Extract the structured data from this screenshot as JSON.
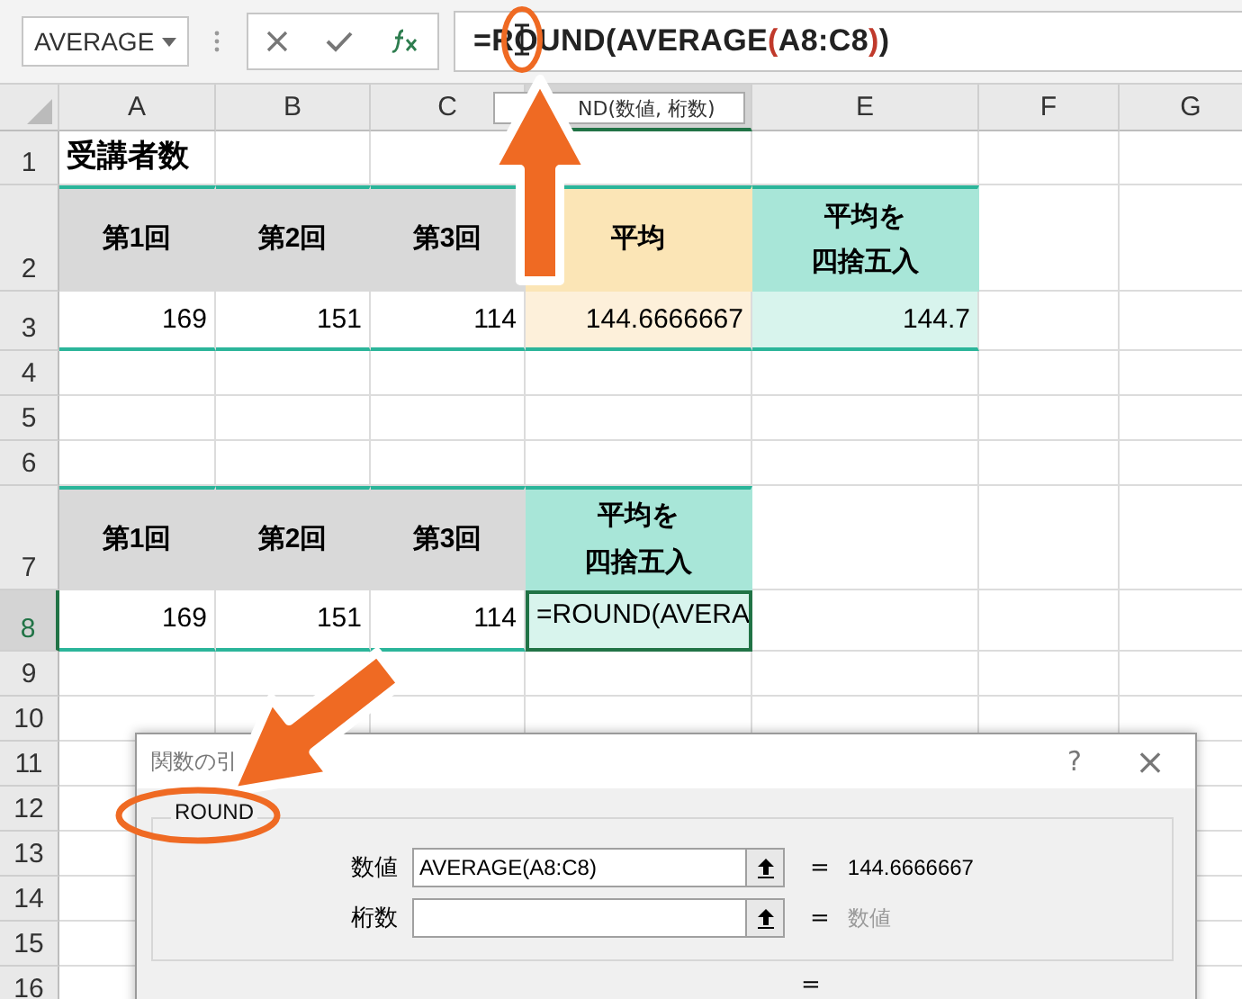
{
  "name_box": {
    "value": "AVERAGE"
  },
  "formula_bar": {
    "segments": [
      {
        "text": "=ROUND(AVERAGE",
        "color": "#222222"
      },
      {
        "text": "(",
        "color": "#c0392b"
      },
      {
        "text": "A8:C8",
        "color": "#222222"
      },
      {
        "text": ")",
        "color": "#c0392b"
      },
      {
        "text": ")",
        "color": "#222222"
      }
    ]
  },
  "tooltip": "ND(数値, 桁数)",
  "columns": [
    {
      "label": "A",
      "selected": false
    },
    {
      "label": "B",
      "selected": false
    },
    {
      "label": "C",
      "selected": false
    },
    {
      "selected": true
    },
    {
      "label": "E",
      "selected": false
    },
    {
      "label": "F",
      "selected": false
    },
    {
      "label": "G",
      "selected": false
    }
  ],
  "rows": [
    {
      "header": "1",
      "selected": false,
      "cells": [
        {
          "kind": "title",
          "text": "受講者数"
        },
        {
          "kind": "empty"
        },
        {
          "kind": "empty"
        },
        {
          "kind": "empty"
        },
        {
          "kind": "empty"
        },
        {
          "kind": "empty"
        },
        {
          "kind": "empty"
        }
      ]
    },
    {
      "header": "2",
      "selected": false,
      "cells": [
        {
          "kind": "header",
          "text": "第1回"
        },
        {
          "kind": "header",
          "text": "第2回"
        },
        {
          "kind": "header",
          "text": "第3回"
        },
        {
          "kind": "avg-header",
          "text": "平均"
        },
        {
          "kind": "round-header",
          "lines": [
            "平均を",
            "四捨五入"
          ]
        },
        {
          "kind": "empty"
        },
        {
          "kind": "empty"
        }
      ]
    },
    {
      "header": "3",
      "selected": false,
      "cells": [
        {
          "kind": "number",
          "text": "169"
        },
        {
          "kind": "number",
          "text": "151"
        },
        {
          "kind": "number",
          "text": "114"
        },
        {
          "kind": "avg-value",
          "text": "144.6666667"
        },
        {
          "kind": "round-value",
          "text": "144.7"
        },
        {
          "kind": "empty"
        },
        {
          "kind": "empty"
        }
      ]
    },
    {
      "header": "4",
      "selected": false,
      "cells": []
    },
    {
      "header": "5",
      "selected": false,
      "cells": []
    },
    {
      "header": "6",
      "selected": false,
      "cells": []
    },
    {
      "header": "7",
      "selected": false,
      "cells": [
        {
          "kind": "header",
          "text": "第1回"
        },
        {
          "kind": "header",
          "text": "第2回"
        },
        {
          "kind": "header",
          "text": "第3回"
        },
        {
          "kind": "round-header",
          "lines": [
            "平均を",
            "四捨五入"
          ]
        },
        {
          "kind": "empty"
        },
        {
          "kind": "empty"
        },
        {
          "kind": "empty"
        }
      ]
    },
    {
      "header": "8",
      "selected": true,
      "cells": [
        {
          "kind": "number",
          "text": "169"
        },
        {
          "kind": "number",
          "text": "151"
        },
        {
          "kind": "number",
          "text": "114"
        },
        {
          "kind": "editing",
          "text": "=ROUND(AVERA"
        },
        {
          "kind": "empty"
        },
        {
          "kind": "empty"
        },
        {
          "kind": "empty"
        }
      ]
    },
    {
      "header": "9",
      "selected": false,
      "cells": []
    },
    {
      "header": "10",
      "selected": false,
      "cells": []
    },
    {
      "header": "11",
      "selected": false,
      "cells": []
    },
    {
      "header": "12",
      "selected": false,
      "cells": []
    },
    {
      "header": "13",
      "selected": false,
      "cells": []
    },
    {
      "header": "14",
      "selected": false,
      "cells": []
    },
    {
      "header": "15",
      "selected": false,
      "cells": []
    },
    {
      "header": "16",
      "selected": false,
      "cells": []
    }
  ],
  "dialog": {
    "title": "関数の引",
    "help": "?",
    "close": "×",
    "function_name": "ROUND",
    "arguments": [
      {
        "label": "数値",
        "value": "AVERAGE(A8:C8)",
        "sign": "=",
        "result": "144.6666667",
        "result_muted": false
      },
      {
        "label": "桁数",
        "sign": "=",
        "result": "数値",
        "result_muted": true
      }
    ],
    "result_sign": "="
  }
}
